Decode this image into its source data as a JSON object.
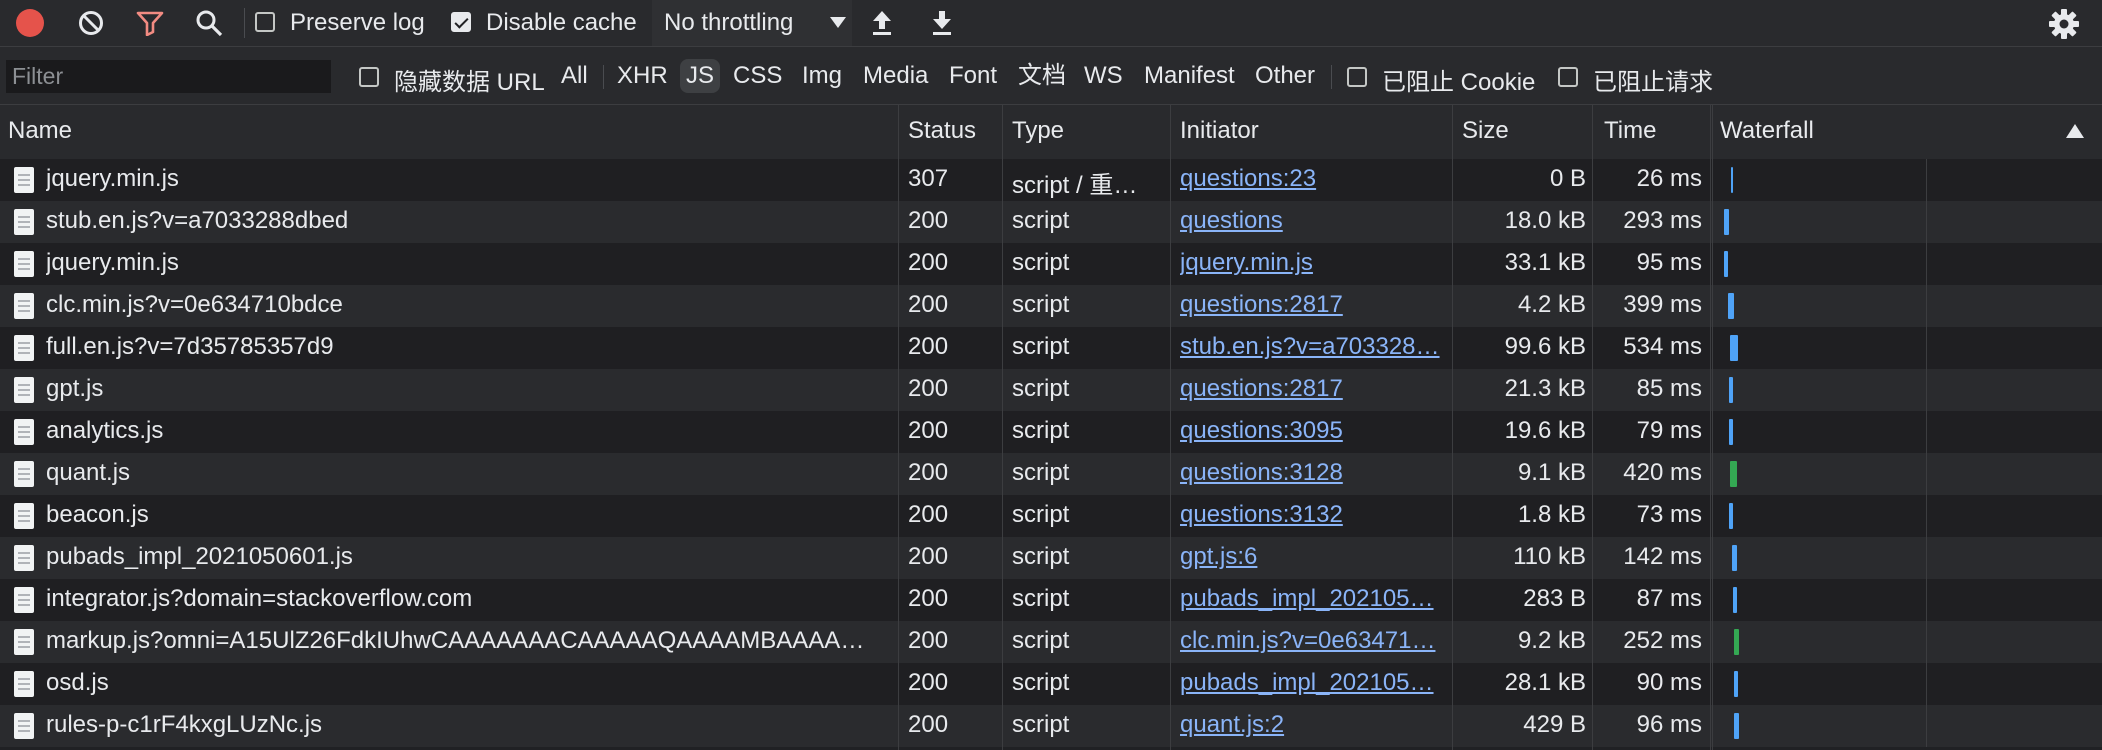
{
  "toolbar": {
    "preserve_log": "Preserve log",
    "disable_cache": "Disable cache",
    "preserve_checked": false,
    "disable_checked": true,
    "throttling": "No throttling"
  },
  "filterbar": {
    "filter_placeholder": "Filter",
    "hide_data_url": "隐藏数据 URL",
    "types": [
      "All",
      "XHR",
      "JS",
      "CSS",
      "Img",
      "Media",
      "Font",
      "文档",
      "WS",
      "Manifest",
      "Other"
    ],
    "active_type": "JS",
    "blocked_cookies": "已阻止 Cookie",
    "blocked_requests": "已阻止请求"
  },
  "columns": {
    "name": "Name",
    "status": "Status",
    "type": "Type",
    "initiator": "Initiator",
    "size": "Size",
    "time": "Time",
    "waterfall": "Waterfall"
  },
  "colors": {
    "waterfall_blue": "#4fa3f7",
    "waterfall_green": "#34a853",
    "link": "#8ab4f8"
  },
  "rows": [
    {
      "name": "jquery.min.js",
      "status": "307",
      "type": "script / 重…",
      "initiator": "questions:23",
      "size": "0 B",
      "time": "26 ms"
    },
    {
      "name": "stub.en.js?v=a7033288dbed",
      "status": "200",
      "type": "script",
      "initiator": "questions",
      "size": "18.0 kB",
      "time": "293 ms"
    },
    {
      "name": "jquery.min.js",
      "status": "200",
      "type": "script",
      "initiator": "jquery.min.js",
      "size": "33.1 kB",
      "time": "95 ms"
    },
    {
      "name": "clc.min.js?v=0e634710bdce",
      "status": "200",
      "type": "script",
      "initiator": "questions:2817",
      "size": "4.2 kB",
      "time": "399 ms"
    },
    {
      "name": "full.en.js?v=7d35785357d9",
      "status": "200",
      "type": "script",
      "initiator": "stub.en.js?v=a703328…",
      "size": "99.6 kB",
      "time": "534 ms"
    },
    {
      "name": "gpt.js",
      "status": "200",
      "type": "script",
      "initiator": "questions:2817",
      "size": "21.3 kB",
      "time": "85 ms"
    },
    {
      "name": "analytics.js",
      "status": "200",
      "type": "script",
      "initiator": "questions:3095",
      "size": "19.6 kB",
      "time": "79 ms"
    },
    {
      "name": "quant.js",
      "status": "200",
      "type": "script",
      "initiator": "questions:3128",
      "size": "9.1 kB",
      "time": "420 ms"
    },
    {
      "name": "beacon.js",
      "status": "200",
      "type": "script",
      "initiator": "questions:3132",
      "size": "1.8 kB",
      "time": "73 ms"
    },
    {
      "name": "pubads_impl_2021050601.js",
      "status": "200",
      "type": "script",
      "initiator": "gpt.js:6",
      "size": "110 kB",
      "time": "142 ms"
    },
    {
      "name": "integrator.js?domain=stackoverflow.com",
      "status": "200",
      "type": "script",
      "initiator": "pubads_impl_202105…",
      "size": "283 B",
      "time": "87 ms"
    },
    {
      "name": "markup.js?omni=A15UlZ26FdkIUhwCAAAAAAACAAAAAQAAAAMBAAAAA…",
      "status": "200",
      "type": "script",
      "initiator": "clc.min.js?v=0e63471…",
      "size": "9.2 kB",
      "time": "252 ms"
    },
    {
      "name": "osd.js",
      "status": "200",
      "type": "script",
      "initiator": "pubads_impl_202105…",
      "size": "28.1 kB",
      "time": "90 ms"
    },
    {
      "name": "rules-p-c1rF4kxgLUzNc.js",
      "status": "200",
      "type": "script",
      "initiator": "quant.js:2",
      "size": "429 B",
      "time": "96 ms"
    }
  ]
}
